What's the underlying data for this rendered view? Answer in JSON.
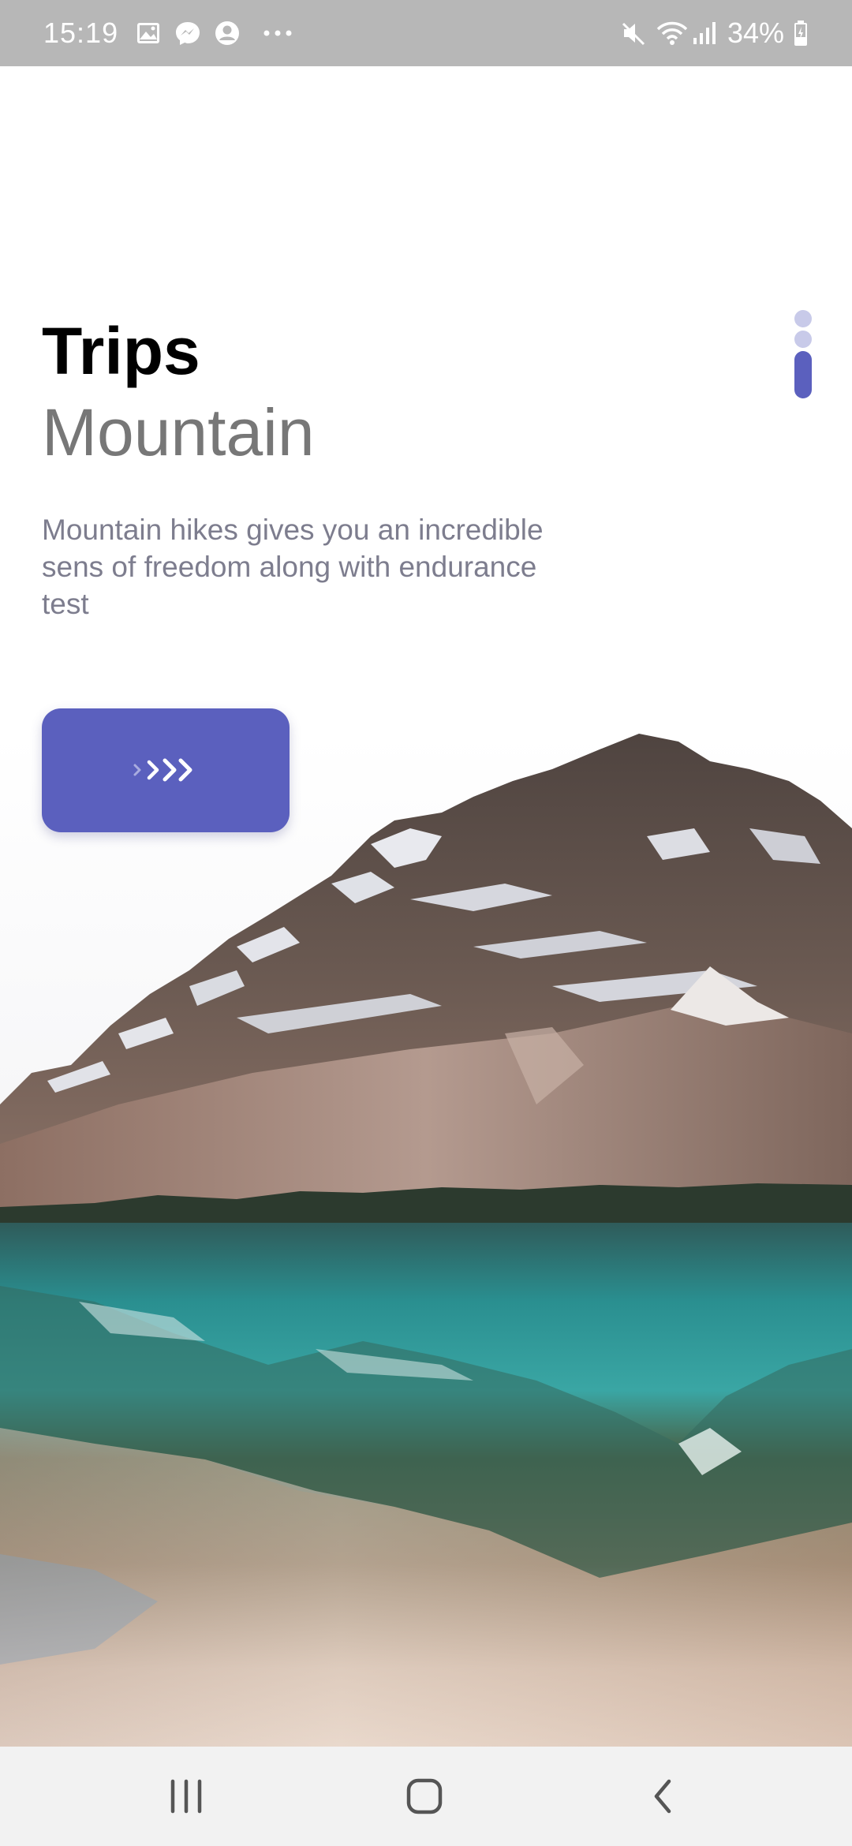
{
  "status_bar": {
    "time": "15:19",
    "battery_text": "34%",
    "left_icons": [
      "gallery-icon",
      "messenger-icon",
      "account-icon",
      "more-icon"
    ],
    "right_icons": [
      "mute-icon",
      "wifi-icon",
      "signal-icon",
      "battery-icon"
    ]
  },
  "main": {
    "title": "Trips",
    "subtitle": "Mountain",
    "description": "Mountain hikes gives you an incredible sens of freedom along with endurance test",
    "next_button_icon": "triple-chevron-right-icon",
    "page_indicator": {
      "pages": 3,
      "active_page": 3
    }
  },
  "navigation_bar": {
    "icons": [
      "recents-icon",
      "home-icon",
      "back-icon"
    ]
  },
  "colors": {
    "accent": "#5b60be",
    "indicator_inactive": "#c8cae9",
    "title": "#000000",
    "subtitle": "#777777",
    "description": "#7d7d8e",
    "status_bar_bg": "#b7b7b7",
    "nav_bar_bg": "#f2f2f2"
  }
}
